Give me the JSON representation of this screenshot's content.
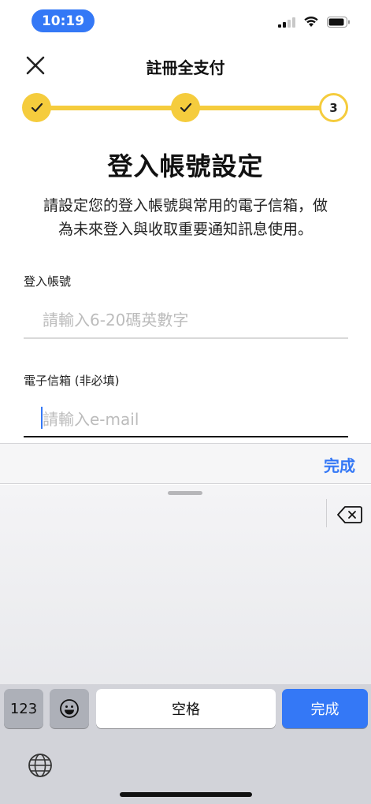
{
  "status_bar": {
    "time": "10:19"
  },
  "header": {
    "title": "註冊全支付"
  },
  "progress": {
    "steps": [
      "done",
      "done",
      "3"
    ],
    "current_step_label": "3"
  },
  "page": {
    "title": "登入帳號設定",
    "description_line1": "請設定您的登入帳號與常用的電子信箱，做",
    "description_line2": "為未來登入與收取重要通知訊息使用。"
  },
  "form": {
    "account": {
      "label": "登入帳號",
      "placeholder": "請輸入6-20碼英數字",
      "value": ""
    },
    "email": {
      "label": "電子信箱 (非必填)",
      "placeholder": "請輸入e-mail",
      "value": ""
    }
  },
  "keyboard": {
    "accessory_done": "完成",
    "key_numbers": "123",
    "key_space": "空格",
    "key_done": "完成",
    "icons": [
      "delete-icon",
      "emoji-icon",
      "globe-icon"
    ]
  },
  "colors": {
    "accent": "#f5cc3d",
    "ios_blue": "#3478f6"
  }
}
